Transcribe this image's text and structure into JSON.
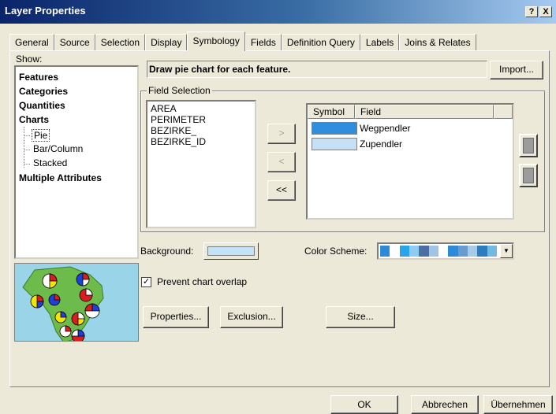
{
  "window": {
    "title": "Layer Properties",
    "help_label": "?",
    "close_label": "X"
  },
  "tabs": [
    "General",
    "Source",
    "Selection",
    "Display",
    "Symbology",
    "Fields",
    "Definition Query",
    "Labels",
    "Joins & Relates"
  ],
  "active_tab": "Symbology",
  "show": {
    "label": "Show:",
    "items": [
      {
        "label": "Features",
        "bold": true
      },
      {
        "label": "Categories",
        "bold": true
      },
      {
        "label": "Quantities",
        "bold": true
      },
      {
        "label": "Charts",
        "bold": true
      },
      {
        "label": "Pie",
        "bold": false,
        "selected": true
      },
      {
        "label": "Bar/Column",
        "bold": false
      },
      {
        "label": "Stacked",
        "bold": false
      },
      {
        "label": "Multiple Attributes",
        "bold": true
      }
    ]
  },
  "description": "Draw pie chart for each feature.",
  "import_button": "Import...",
  "field_selection": {
    "group_label": "Field Selection",
    "fields": [
      "AREA",
      "PERIMETER",
      "BEZIRKE_",
      "BEZIRKE_ID"
    ],
    "add_button": ">",
    "remove_button": "<",
    "remove_all_button": "<<",
    "grid_headers": [
      "Symbol",
      "Field"
    ],
    "rows": [
      {
        "color": "#2e8fdf",
        "field": "Wegpendler"
      },
      {
        "color": "#c6e0f5",
        "field": "Zupendler"
      }
    ]
  },
  "background": {
    "label": "Background:",
    "color": "#c3e2f7"
  },
  "color_scheme": {
    "label": "Color Scheme:",
    "colors": [
      "#2c8ad8",
      "#ffffff",
      "#2aa4e8",
      "#8fcdf0",
      "#4a6fa5",
      "#a0c4e4",
      "#ffffff",
      "#2c8ad8",
      "#6a9ccb",
      "#a6cbe8",
      "#2a7ebf",
      "#73b8e0"
    ]
  },
  "prevent_overlap": {
    "label": "Prevent chart overlap",
    "checked": true
  },
  "buttons": {
    "properties": "Properties...",
    "exclusion": "Exclusion...",
    "size": "Size..."
  },
  "footer": {
    "ok": "OK",
    "cancel": "Abbrechen",
    "apply": "Übernehmen"
  },
  "colors": {
    "map_bg": "#9ad4e8",
    "land": "#6dbb4a"
  }
}
